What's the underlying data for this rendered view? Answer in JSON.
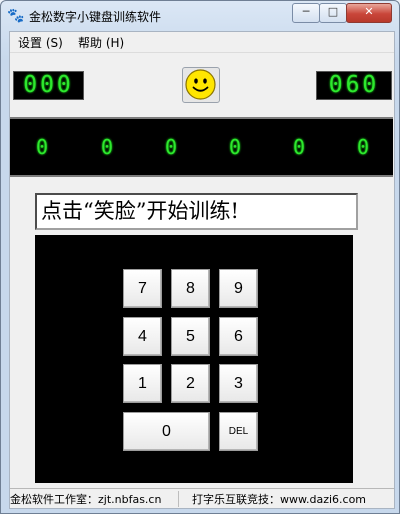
{
  "window": {
    "title": "金松数字小键盘训练软件",
    "min_label": "─",
    "max_label": "□",
    "close_label": "✕",
    "app_icon": "🐾"
  },
  "menu": {
    "settings": "设置 (S)",
    "help": "帮助 (H)"
  },
  "counters": {
    "left": "000",
    "right": "060"
  },
  "smiley_icon": "smiley-face-icon",
  "digit_strip": [
    "0",
    "0",
    "0",
    "0",
    "0",
    "0"
  ],
  "prompt": "点击“笑脸”开始训练!",
  "keypad": {
    "k7": "7",
    "k8": "8",
    "k9": "9",
    "k4": "4",
    "k5": "5",
    "k6": "6",
    "k1": "1",
    "k2": "2",
    "k3": "3",
    "k0": "0",
    "del": "DEL"
  },
  "status": {
    "left": "金松软件工作室：zjt.nbfas.cn",
    "right": "打字乐互联竞技：www.dazi6.com"
  },
  "colors": {
    "led_green": "#2ee82e",
    "smiley_yellow": "#ffe600"
  }
}
